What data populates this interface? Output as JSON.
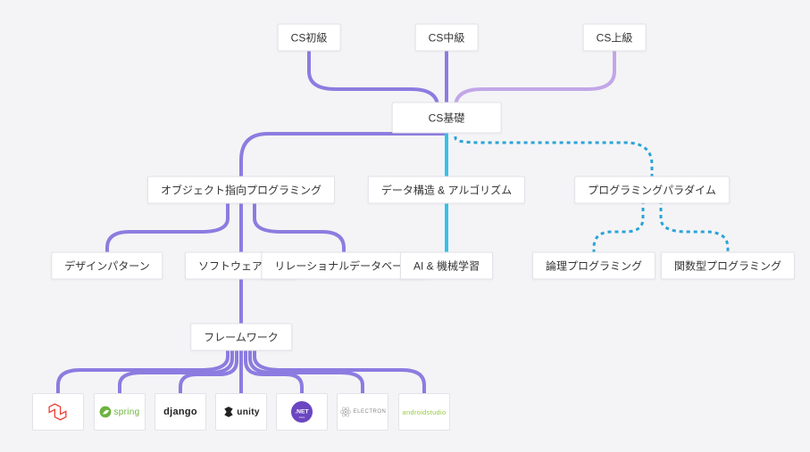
{
  "nodes": {
    "cs_beginner": "CS初級",
    "cs_intermediate": "CS中級",
    "cs_advanced": "CS上級",
    "cs_fundamentals": "CS基礎",
    "oop": "オブジェクト指向プログラミング",
    "dsa": "データ構造 & アルゴリズム",
    "paradigms": "プログラミングパラダイム",
    "design_patterns": "デザインパターン",
    "software_dev": "ソフトウェア開発",
    "rdb": "リレーショナルデータベース",
    "ai_ml": "AI & 機械学習",
    "logic_prog": "論理プログラミング",
    "func_prog": "関数型プログラミング",
    "frameworks": "フレームワーク"
  },
  "framework_items": {
    "laravel": "Laravel",
    "spring": "spring",
    "django": "django",
    "unity": "unity",
    "dotnet": ".NET",
    "electron": "ELECTRON",
    "android_studio": "androidstudio"
  },
  "colors": {
    "purple": "#8c7ce0",
    "cyan": "#33c3e8",
    "dotted": "#2aa3d8",
    "laravel": "#ef3e33",
    "spring": "#6db33f",
    "unity": "#222222",
    "dotnet_bg": "#6b46c1",
    "electron": "#b0b0b0",
    "android": "#95c93f"
  }
}
